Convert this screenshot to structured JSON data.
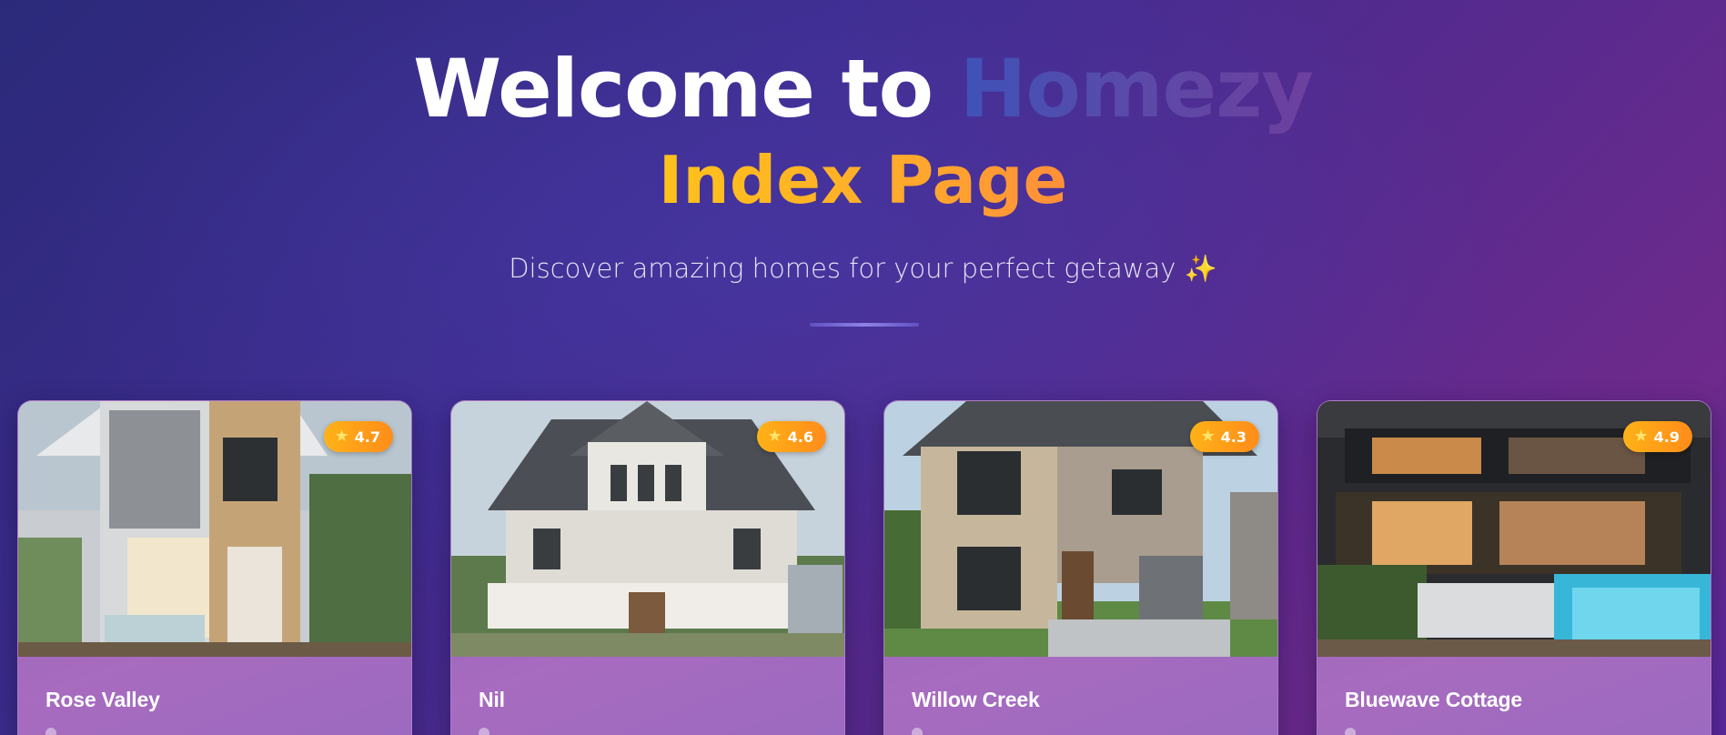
{
  "hero": {
    "title_prefix": "Welcome to ",
    "brand": "Homezy",
    "title_line2": "Index Page",
    "subtitle": "Discover amazing homes for your perfect getaway ✨"
  },
  "cards": [
    {
      "title": "Rose Valley",
      "rating": "4.7"
    },
    {
      "title": "Nil",
      "rating": "4.6"
    },
    {
      "title": "Willow Creek",
      "rating": "4.3"
    },
    {
      "title": "Bluewave Cottage",
      "rating": "4.9"
    }
  ],
  "colors": {
    "brand_gradient": [
      "#3f52b8",
      "#6d3f9e"
    ],
    "accent_gradient": [
      "#ffc21a",
      "#ff8f3a"
    ],
    "rating_badge": "#ffa21a"
  }
}
